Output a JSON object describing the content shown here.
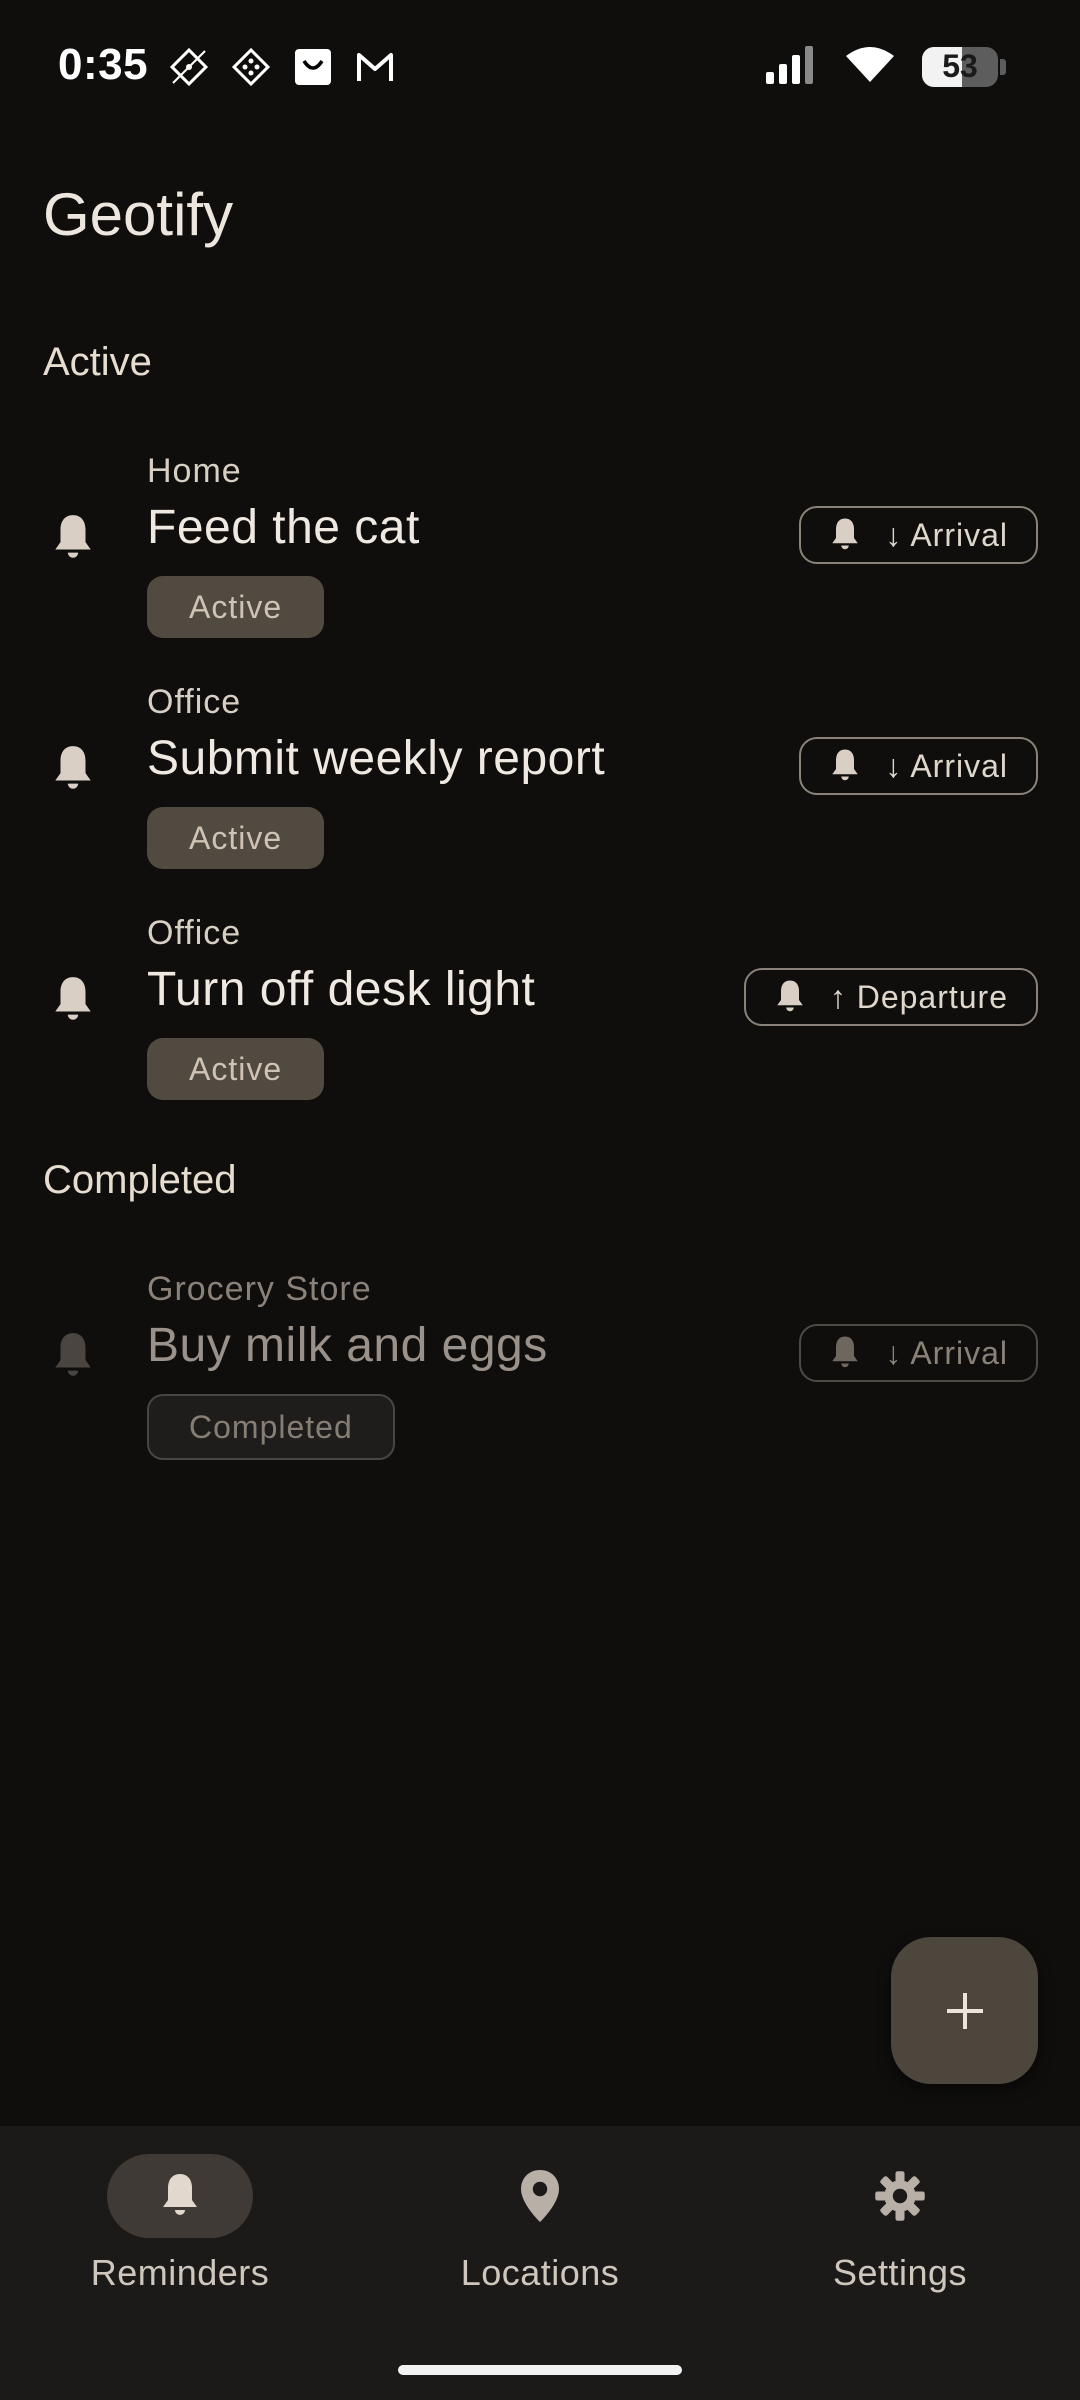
{
  "status_bar": {
    "time": "0:35",
    "notification_icons": [
      "diamond-app-icon",
      "diamond-grid-icon",
      "shopping-bag-icon",
      "gmail-icon"
    ],
    "battery_level": "53",
    "battery_fraction": 0.53
  },
  "app": {
    "title": "Geotify"
  },
  "sections": {
    "active_label": "Active",
    "completed_label": "Completed"
  },
  "reminders": [
    {
      "location": "Home",
      "title": "Feed the cat",
      "status": "Active",
      "trigger": "↓ Arrival"
    },
    {
      "location": "Office",
      "title": "Submit weekly report",
      "status": "Active",
      "trigger": "↓ Arrival"
    },
    {
      "location": "Office",
      "title": "Turn off desk light",
      "status": "Active",
      "trigger": "↑ Departure"
    }
  ],
  "completed": [
    {
      "location": "Grocery Store",
      "title": "Buy milk and eggs",
      "status": "Completed",
      "trigger": "↓ Arrival"
    }
  ],
  "fab": {
    "icon": "plus-icon"
  },
  "bottom_nav": [
    {
      "label": "Reminders",
      "icon": "bell-icon",
      "active": true
    },
    {
      "label": "Locations",
      "icon": "location-pin-icon",
      "active": false
    },
    {
      "label": "Settings",
      "icon": "gear-icon",
      "active": false
    }
  ],
  "colors": {
    "background": "#0f0e0d",
    "chip_active": "#514a40",
    "accent_bell": "#d9cfc4",
    "nav_background": "#1c1a18"
  }
}
